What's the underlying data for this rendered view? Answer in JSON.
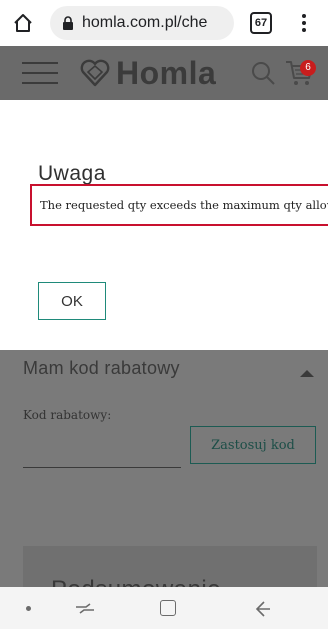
{
  "browser": {
    "url": "homla.com.pl/che",
    "tab_count": "67"
  },
  "site_header": {
    "logo_text": "Homla",
    "cart_count": "6"
  },
  "modal": {
    "title": "Uwaga",
    "error_message": "The requested qty exceeds the maximum qty allowed in shopping cart",
    "ok_label": "OK"
  },
  "coupon": {
    "heading": "Mam kod rabatowy",
    "label": "Kod rabatowy:",
    "input_value": "",
    "apply_label": "Zastosuj kod"
  },
  "summary": {
    "title": "Podsumowanie"
  },
  "colors": {
    "accent": "#1f8a7a",
    "error_border": "#c8102e",
    "badge": "#c81d1d",
    "overlay": "#7a7a7a"
  }
}
